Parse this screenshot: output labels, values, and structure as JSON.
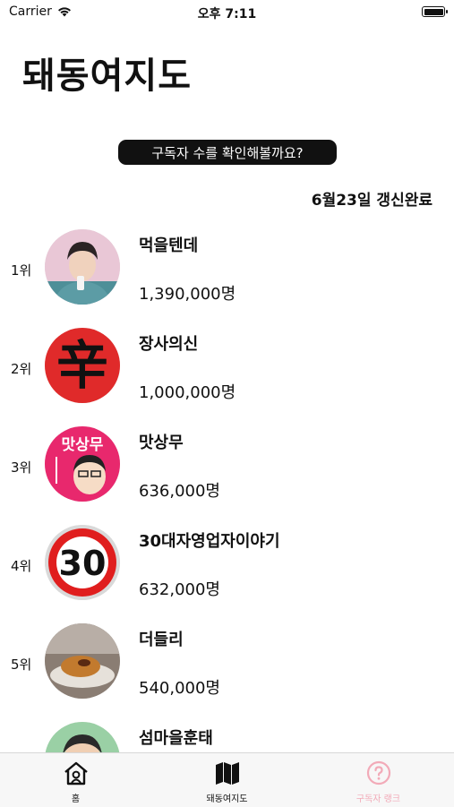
{
  "status_bar": {
    "carrier": "Carrier",
    "time": "오후 7:11",
    "battery_level": 1.0
  },
  "page_title": "돼동여지도",
  "subscribe_button_label": "구독자 수를 확인해볼까요?",
  "update_note": "6월23일 갱신완료",
  "ranking": [
    {
      "rank": "1위",
      "name": "먹을텐데",
      "subscribers": "1,390,000명"
    },
    {
      "rank": "2위",
      "name": "장사의신",
      "subscribers": "1,000,000명",
      "avatar_text": "辛"
    },
    {
      "rank": "3위",
      "name": "맛상무",
      "subscribers": "636,000명",
      "avatar_text": "맛상무"
    },
    {
      "rank": "4위",
      "name": "30대자영업자이야기",
      "subscribers": "632,000명",
      "avatar_text": "30"
    },
    {
      "rank": "5위",
      "name": "더들리",
      "subscribers": "540,000명"
    },
    {
      "rank": "",
      "name": "섬마을훈태",
      "subscribers": ""
    }
  ],
  "tab_bar": [
    {
      "label": "홈",
      "icon": "home-icon",
      "color": "#111111"
    },
    {
      "label": "돼동여지도",
      "icon": "map-icon",
      "color": "#111111"
    },
    {
      "label": "구독자 랭크",
      "icon": "question-icon",
      "color": "#f2aab8"
    }
  ]
}
